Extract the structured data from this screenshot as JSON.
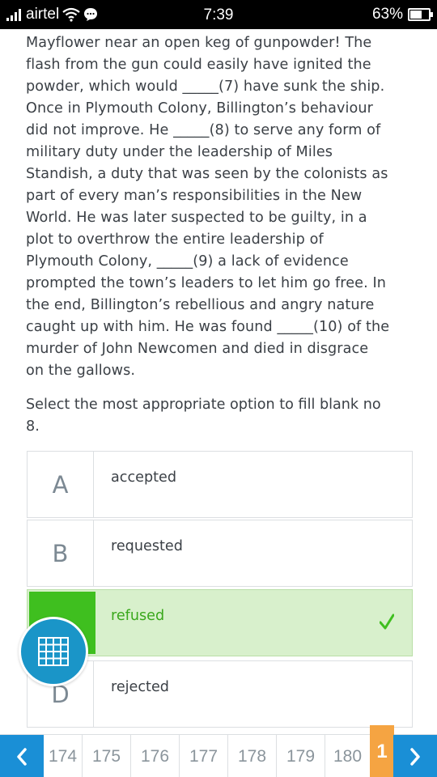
{
  "status_bar": {
    "carrier": "airtel",
    "time": "7:39",
    "battery": "63%",
    "battery_level": 0.63
  },
  "passage_lines": [
    "Mayflower near an open keg of gunpowder! The",
    "flash from the gun could easily have ignited the",
    "powder, which would _____(7) have sunk the ship.",
    "Once in Plymouth Colony, Billington’s behaviour",
    "did not improve. He _____(8) to serve any form of",
    "military duty under the leadership of Miles",
    "Standish, a duty that was seen by the colonists as",
    "part of every man’s responsibilities in the New",
    "World. He was later suspected to be guilty, in a",
    "plot to overthrow the entire leadership of",
    "Plymouth Colony, _____(9) a lack of evidence",
    "prompted the town’s leaders to let him go free. In",
    "the end, Billington’s rebellious and angry nature",
    "caught up with him. He was found _____(10) of the",
    "murder of John Newcomen and died in disgrace",
    "on the gallows."
  ],
  "question_lines": [
    "Select the most appropriate option to fill blank no",
    "8."
  ],
  "options": [
    {
      "letter": "A",
      "text": "accepted"
    },
    {
      "letter": "B",
      "text": "requested"
    },
    {
      "letter": "C",
      "text": "refused"
    },
    {
      "letter": "D",
      "text": "rejected"
    }
  ],
  "correct_option": "C",
  "pager": {
    "pages": [
      "174",
      "175",
      "176",
      "177",
      "178",
      "179",
      "180"
    ],
    "current": "1"
  },
  "icons": {
    "prev": "chevron-left-icon",
    "next": "chevron-right-icon",
    "grid": "question-grid-icon",
    "check": "checkmark-icon"
  },
  "colors": {
    "accent_blue": "#1a8fd6",
    "correct_green": "#3fbf1f",
    "correct_bg": "#d8f0cc",
    "current_page_orange": "#f5a442"
  }
}
